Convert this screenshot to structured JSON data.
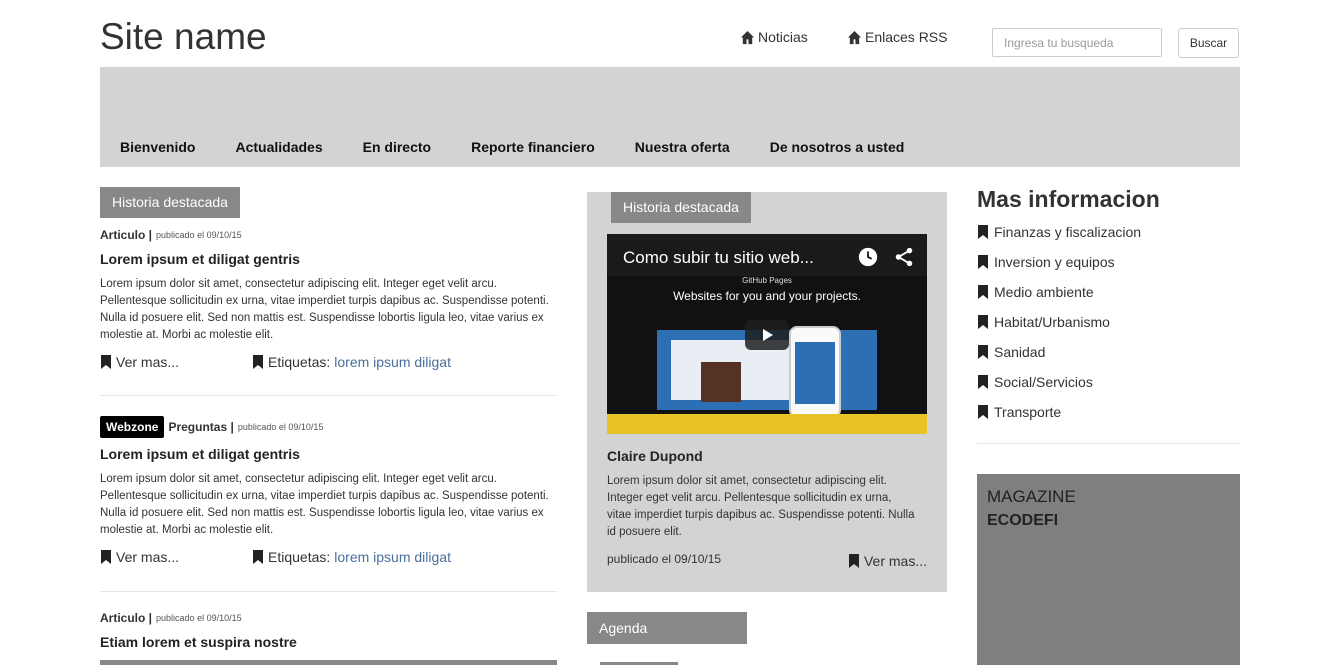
{
  "header": {
    "site_name": "Site name",
    "links": [
      {
        "label": "Noticias",
        "icon": "home-icon"
      },
      {
        "label": "Enlaces RSS",
        "icon": "home-icon"
      }
    ],
    "search": {
      "placeholder": "Ingresa tu busqueda",
      "button_label": "Buscar"
    }
  },
  "nav": {
    "items": [
      "Bienvenido",
      "Actualidades",
      "En directo",
      "Reporte financiero",
      "Nuestra oferta",
      "De nosotros a usted"
    ]
  },
  "left": {
    "section_tag": "Historia destacada",
    "articles": [
      {
        "badge": "",
        "category": "Articulo |",
        "published": "publicado el 09/10/15",
        "title": "Lorem ipsum et diligat gentris",
        "body": "Lorem ipsum dolor sit amet, consectetur adipiscing elit. Integer eget velit arcu. Pellentesque sollicitudin ex urna, vitae imperdiet turpis dapibus ac. Suspendisse potenti. Nulla id posuere elit. Sed non mattis est. Suspendisse lobortis ligula leo, vitae varius ex molestie at. Morbi ac molestie elit.",
        "read_more": "Ver mas...",
        "tags_label": "Etiquetas:",
        "tags_value": "lorem ipsum diligat"
      },
      {
        "badge": "Webzone",
        "category": "Preguntas |",
        "published": "publicado el 09/10/15",
        "title": "Lorem ipsum et diligat gentris",
        "body": "Lorem ipsum dolor sit amet, consectetur adipiscing elit. Integer eget velit arcu. Pellentesque sollicitudin ex urna, vitae imperdiet turpis dapibus ac. Suspendisse potenti. Nulla id posuere elit. Sed non mattis est. Suspendisse lobortis ligula leo, vitae varius ex molestie at. Morbi ac molestie elit.",
        "read_more": "Ver mas...",
        "tags_label": "Etiquetas:",
        "tags_value": "lorem ipsum diligat"
      },
      {
        "badge": "",
        "category": "Articulo |",
        "published": "publicado el 09/10/15",
        "title": "Etiam lorem et suspira nostre"
      }
    ]
  },
  "featured": {
    "section_tag": "Historia destacada",
    "video_title": "Como subir tu sitio web...",
    "video_subtitle": "GitHub Pages",
    "video_heading": "Websites for you and your projects.",
    "author": "Claire Dupond",
    "body": "Lorem ipsum dolor sit amet, consectetur adipiscing elit. Integer eget velit arcu. Pellentesque sollicitudin ex urna, vitae imperdiet turpis dapibus ac. Suspendisse potenti. Nulla id posuere elit.",
    "published": "publicado el 09/10/15",
    "read_more": "Ver mas..."
  },
  "agenda": {
    "label": "Agenda"
  },
  "sidebar": {
    "title": "Mas informacion",
    "items": [
      "Finanzas y fiscalizacion",
      "Inversion y equipos",
      "Medio ambiente",
      "Habitat/Urbanismo",
      "Sanidad",
      "Social/Servicios",
      "Transporte"
    ],
    "magazine_line1": "MAGAZINE",
    "magazine_line2": "ECODEFI"
  },
  "colors": {
    "nav_background": "#d3d3d3",
    "tag_background": "#888888",
    "link": "#4a6f9c",
    "badge_background": "#000000"
  }
}
